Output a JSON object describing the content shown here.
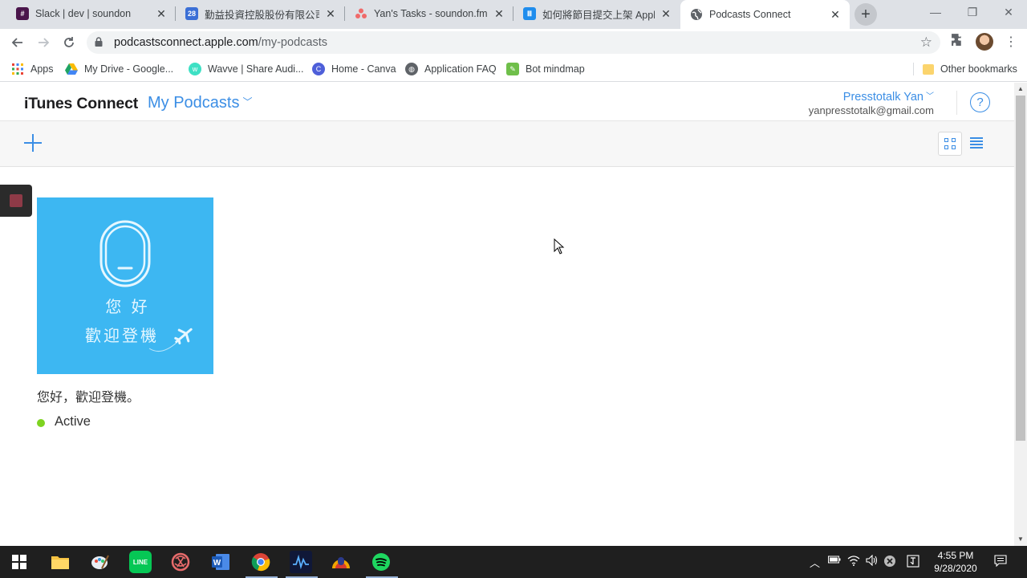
{
  "browser": {
    "tabs": [
      {
        "title": "Slack | dev | soundon",
        "icon": "slack-icon",
        "active": false
      },
      {
        "title": "勤益投資控股股份有限公司",
        "icon": "calendar-icon",
        "active": false
      },
      {
        "title": "Yan's Tasks - soundon.fm - A",
        "icon": "asana-icon",
        "active": false
      },
      {
        "title": "如何將節目提交上架 Apple",
        "icon": "intercom-icon",
        "active": false
      },
      {
        "title": "Podcasts Connect",
        "icon": "globe-icon",
        "active": true
      }
    ],
    "new_tab_label": "+",
    "address": {
      "domain": "podcastsconnect.apple.com",
      "path": "/my-podcasts"
    },
    "bookmarks": [
      {
        "label": "Apps",
        "icon": "apps-grid-icon"
      },
      {
        "label": "My Drive - Google...",
        "icon": "google-drive-icon"
      },
      {
        "label": "Wavve | Share Audi...",
        "icon": "wavve-icon"
      },
      {
        "label": "Home - Canva",
        "icon": "canva-icon"
      },
      {
        "label": "Application FAQ",
        "icon": "globe-icon"
      },
      {
        "label": "Bot mindmap",
        "icon": "mindmap-icon"
      }
    ],
    "other_bookmarks": "Other bookmarks"
  },
  "app": {
    "brand": "iTunes Connect",
    "section": "My Podcasts",
    "user": {
      "name": "Presstotalk Yan",
      "email": "yanpresstotalk@gmail.com"
    },
    "help_label": "?"
  },
  "podcasts": [
    {
      "title": "您好，歡迎登機。",
      "status": "Active",
      "status_color": "#7ed321",
      "art": {
        "background": "#3db7f2",
        "line1": "您 好",
        "line2": "歡迎登機"
      }
    }
  ],
  "taskbar": {
    "apps": [
      "windows-start-icon",
      "file-explorer-icon",
      "paint-icon",
      "line-icon",
      "app-icon",
      "word-icon",
      "chrome-icon",
      "audio-editor-icon",
      "soundon-icon",
      "spotify-icon"
    ],
    "time": "4:55 PM",
    "date": "9/28/2020"
  },
  "colors": {
    "accent": "#3b8ee5",
    "tabstrip": "#dee1e6"
  }
}
